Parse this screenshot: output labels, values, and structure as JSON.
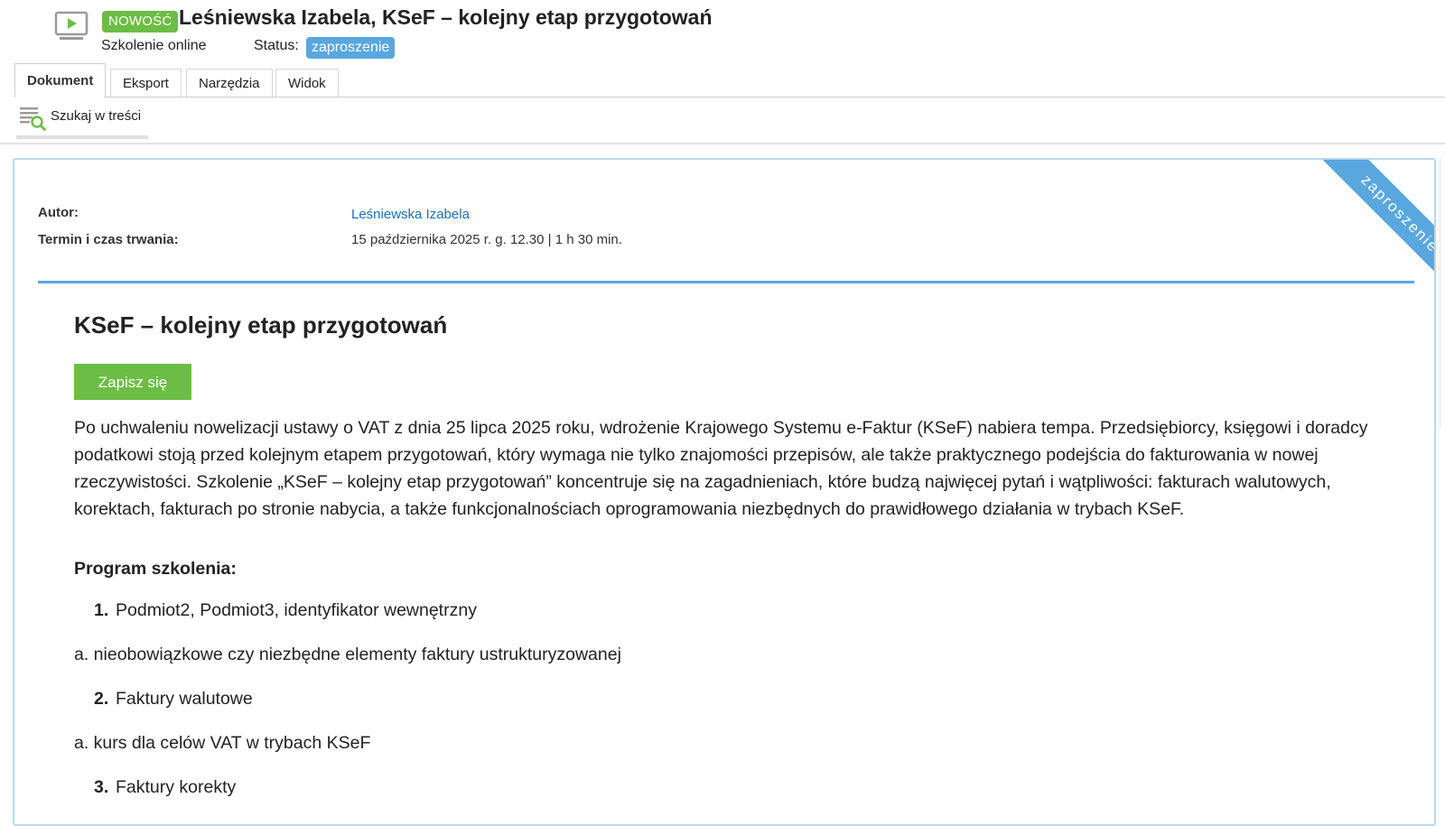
{
  "header": {
    "icon": "video-play-icon",
    "badge_new": "NOWOŚĆ",
    "title": "Leśniewska Izabela, KSeF – kolejny etap przygotowań",
    "subtitle": "Szkolenie online",
    "status_label": "Status:",
    "status_value": "zaproszenie"
  },
  "tabs": [
    {
      "label": "Dokument",
      "active": true
    },
    {
      "label": "Eksport",
      "active": false
    },
    {
      "label": "Narzędzia",
      "active": false
    },
    {
      "label": "Widok",
      "active": false
    }
  ],
  "toolbar": {
    "search_icon": "search-in-text-icon",
    "search_label": "Szukaj w treści"
  },
  "document": {
    "ribbon": "zaproszenie",
    "meta": {
      "author_label": "Autor:",
      "author_value": "Leśniewska Izabela",
      "date_label": "Termin i czas trwania:",
      "date_value": "15 października 2025 r. g. 12.30 | 1 h 30 min."
    },
    "heading": "KSeF – kolejny etap przygotowań",
    "cta_label": "Zapisz się",
    "intro": "Po uchwaleniu nowelizacji ustawy o VAT z dnia 25 lipca 2025 roku, wdrożenie Krajowego Systemu e-Faktur (KSeF) nabiera tempa. Przedsiębiorcy, księgowi i doradcy podatkowi stoją przed kolejnym etapem przygotowań, który wymaga nie tylko znajomości przepisów, ale także praktycznego podejścia do fakturowania w nowej rzeczywistości. Szkolenie „KSeF – kolejny etap przygotowań” koncentruje się na zagadnieniach, które budzą najwięcej pytań i wątpliwości: fakturach walutowych, korektach, fakturach po stronie nabycia, a także funkcjonalnościach oprogramowania niezbędnych do prawidłowego działania w trybach KSeF.",
    "program_heading": "Program szkolenia:",
    "program": [
      {
        "num": "1.",
        "text": "Podmiot2, Podmiot3, identyfikator wewnętrzny",
        "sub": "a. nieobowiązkowe czy niezbędne elementy faktury ustrukturyzowanej"
      },
      {
        "num": "2.",
        "text": "Faktury walutowe",
        "sub": "a. kurs dla celów VAT w trybach KSeF"
      },
      {
        "num": "3.",
        "text": "Faktury korekty",
        "sub": ""
      }
    ]
  },
  "colors": {
    "accent_green": "#6cbd45",
    "accent_blue": "#5aa7e0",
    "link_blue": "#1f6db5",
    "card_border": "#b9d8ef"
  }
}
